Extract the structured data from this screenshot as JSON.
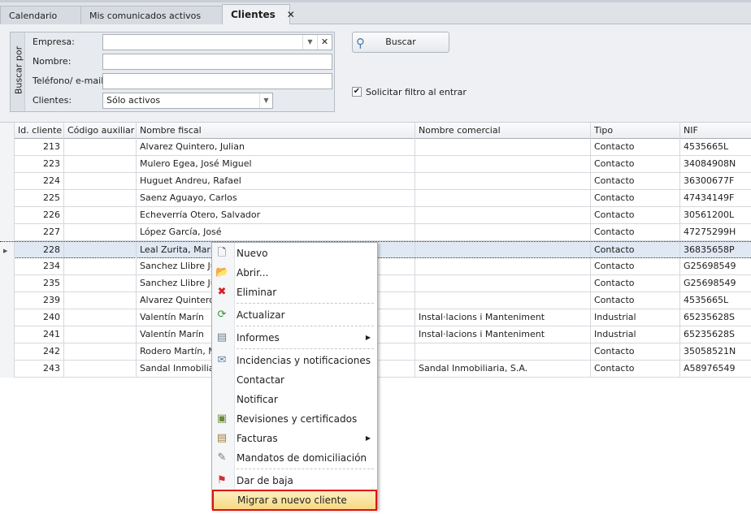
{
  "tabs": [
    {
      "label": "Calendario"
    },
    {
      "label": "Mis comunicados activos"
    },
    {
      "label": "Clientes",
      "close": "✕"
    }
  ],
  "filter": {
    "group_label": "Buscar por",
    "empresa_label": "Empresa:",
    "empresa_value": "",
    "nombre_label": "Nombre:",
    "nombre_value": "",
    "telefono_label": "Teléfono/ e-mail:",
    "telefono_value": "",
    "clientes_label": "Clientes:",
    "clientes_value": "Sólo activos",
    "buscar_label": "Buscar",
    "solicitar_label": "Solicitar filtro al entrar",
    "solicitar_checked": true
  },
  "grid": {
    "columns": [
      "Id. cliente",
      "Código auxiliar",
      "Nombre fiscal",
      "Nombre comercial",
      "Tipo",
      "NIF"
    ],
    "rows": [
      {
        "id": "213",
        "aux": "",
        "fiscal": "Alvarez Quintero, Julian",
        "comercial": "",
        "tipo": "Contacto",
        "nif": "4535665L"
      },
      {
        "id": "223",
        "aux": "",
        "fiscal": "Mulero Egea, José Miguel",
        "comercial": "",
        "tipo": "Contacto",
        "nif": "34084908N"
      },
      {
        "id": "224",
        "aux": "",
        "fiscal": "Huguet Andreu, Rafael",
        "comercial": "",
        "tipo": "Contacto",
        "nif": "36300677F"
      },
      {
        "id": "225",
        "aux": "",
        "fiscal": "Saenz Aguayo, Carlos",
        "comercial": "",
        "tipo": "Contacto",
        "nif": "47434149F"
      },
      {
        "id": "226",
        "aux": "",
        "fiscal": "Echeverría Otero, Salvador",
        "comercial": "",
        "tipo": "Contacto",
        "nif": "30561200L"
      },
      {
        "id": "227",
        "aux": "",
        "fiscal": "López García, José",
        "comercial": "",
        "tipo": "Contacto",
        "nif": "47275299H"
      },
      {
        "id": "228",
        "aux": "",
        "fiscal": "Leal Zurita, Maria",
        "comercial": "",
        "tipo": "Contacto",
        "nif": "36835658P"
      },
      {
        "id": "234",
        "aux": "",
        "fiscal": "Sanchez Llibre Julia",
        "comercial": "",
        "tipo": "Contacto",
        "nif": "G25698549"
      },
      {
        "id": "235",
        "aux": "",
        "fiscal": "Sanchez Llibre Julia",
        "comercial": "",
        "tipo": "Contacto",
        "nif": "G25698549"
      },
      {
        "id": "239",
        "aux": "",
        "fiscal": "Alvarez Quintero,",
        "comercial": "",
        "tipo": "Contacto",
        "nif": "4535665L"
      },
      {
        "id": "240",
        "aux": "",
        "fiscal": "Valentín Marín",
        "comercial": "Instal·lacions i Manteniment",
        "tipo": "Industrial",
        "nif": "65235628S"
      },
      {
        "id": "241",
        "aux": "",
        "fiscal": "Valentín Marín",
        "comercial": "Instal·lacions i Manteniment",
        "tipo": "Industrial",
        "nif": "65235628S"
      },
      {
        "id": "242",
        "aux": "",
        "fiscal": "Rodero Martín, Mir",
        "comercial": "",
        "tipo": "Contacto",
        "nif": "35058521N"
      },
      {
        "id": "243",
        "aux": "",
        "fiscal": "Sandal Inmobiliaria",
        "comercial": "Sandal Inmobiliaria, S.A.",
        "tipo": "Contacto",
        "nif": "A58976549"
      }
    ],
    "selected_index": 6
  },
  "menu": [
    {
      "label": "Nuevo",
      "icon": "new-document-icon"
    },
    {
      "label": "Abrir...",
      "icon": "folder-open-icon"
    },
    {
      "label": "Eliminar",
      "icon": "delete-icon",
      "sep_after": true
    },
    {
      "label": "Actualizar",
      "icon": "refresh-icon",
      "sep_after": true
    },
    {
      "label": "Informes",
      "icon": "report-icon",
      "submenu": true,
      "sep_after": true
    },
    {
      "label": "Incidencias y notificaciones",
      "icon": "incidents-icon"
    },
    {
      "label": "Contactar"
    },
    {
      "label": "Notificar"
    },
    {
      "label": "Revisiones y certificados",
      "icon": "certificate-icon"
    },
    {
      "label": "Facturas",
      "icon": "invoice-icon",
      "submenu": true
    },
    {
      "label": "Mandatos de domiciliación",
      "icon": "mandate-icon",
      "sep_after": true
    },
    {
      "label": "Dar de baja",
      "icon": "flag-icon"
    },
    {
      "label": "Migrar a nuevo cliente",
      "highlighted": true
    }
  ]
}
